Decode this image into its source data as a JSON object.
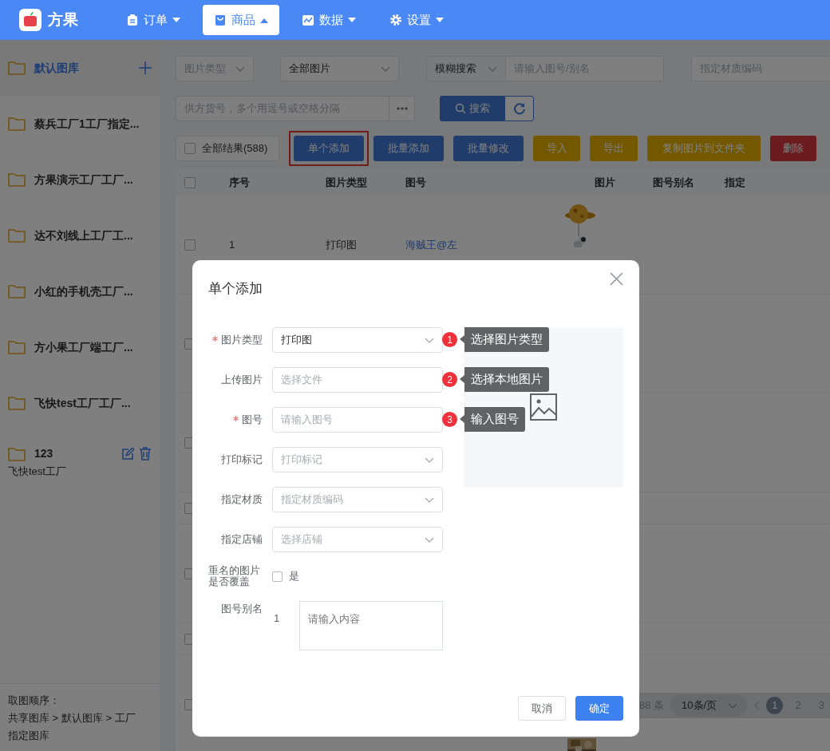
{
  "nav": {
    "brand": "方果",
    "items": [
      {
        "label": "订单",
        "kind": "clipboard",
        "selected": false
      },
      {
        "label": "商品",
        "kind": "bag",
        "selected": true
      },
      {
        "label": "数据",
        "kind": "chart",
        "selected": false
      },
      {
        "label": "设置",
        "kind": "gear",
        "selected": false
      }
    ]
  },
  "sidebar": {
    "libraries": [
      {
        "name": "默认图库",
        "selected": true,
        "hovered": false
      },
      {
        "name": "蔡兵工厂1工厂指定...",
        "selected": false,
        "hovered": false
      },
      {
        "name": "方果演示工厂工厂...",
        "selected": false,
        "hovered": false
      },
      {
        "name": "达不刘线上工厂工...",
        "selected": false,
        "hovered": false
      },
      {
        "name": "小红的手机壳工厂...",
        "selected": false,
        "hovered": false
      },
      {
        "name": "方小果工厂端工厂...",
        "selected": false,
        "hovered": false
      },
      {
        "name": "飞快test工厂工厂...",
        "selected": false,
        "hovered": false
      },
      {
        "name": "123",
        "subtitle": "飞快test工厂",
        "selected": false,
        "hovered": true
      }
    ],
    "note_title": "取图顺序：",
    "note": "共享图库 > 默认图库 > 工厂指定图库"
  },
  "filters": {
    "type_placeholder": "图片类型",
    "scope_value": "全部图片",
    "search_mode": "模糊搜索",
    "search_placeholder": "请输入图号/别名",
    "material_placeholder": "指定材质编码",
    "supplier_placeholder": "供方货号，多个用逗号或空格分隔",
    "search_button": "搜索"
  },
  "toolbar": {
    "select_all": {
      "label": "全部结果(588)",
      "checked": false
    },
    "buttons": [
      {
        "label": "单个添加",
        "kind": "primary",
        "highlighted": true
      },
      {
        "label": "批量添加",
        "kind": "primary",
        "highlighted": false
      },
      {
        "label": "批量修改",
        "kind": "primary",
        "highlighted": false
      },
      {
        "label": "导入",
        "kind": "warning",
        "highlighted": false
      },
      {
        "label": "导出",
        "kind": "warning",
        "highlighted": false
      },
      {
        "label": "复制图片到文件夹",
        "kind": "warning",
        "highlighted": false
      },
      {
        "label": "删除",
        "kind": "danger",
        "highlighted": false
      }
    ]
  },
  "table": {
    "header_checked": false,
    "columns": [
      "序号",
      "图片类型",
      "图号",
      "图片",
      "图号别名",
      "指定"
    ],
    "rows": [
      {
        "kind": "picture",
        "checked": false,
        "cells": [
          "1",
          "打印图",
          "海贼王@左"
        ]
      },
      {
        "kind": "tall",
        "checked": false
      },
      {
        "kind": "tall",
        "checked": false
      },
      {
        "kind": "short",
        "checked": false
      },
      {
        "kind": "tall",
        "checked": false
      },
      {
        "kind": "short",
        "checked": false
      },
      {
        "kind": "picture",
        "checked": false
      }
    ]
  },
  "pagination": {
    "total": "88 条",
    "page_size": "10条/页",
    "pages": [
      {
        "label": "1",
        "selected": true
      },
      {
        "label": "2",
        "selected": false
      },
      {
        "label": "3",
        "selected": false
      }
    ]
  },
  "dialog": {
    "title": "单个添加",
    "fields": [
      {
        "kind": "select",
        "label": "图片类型",
        "required": true,
        "value": "打印图",
        "hint": {
          "number": "1",
          "text": "选择图片类型"
        }
      },
      {
        "kind": "input",
        "label": "上传图片",
        "required": false,
        "placeholder": "选择文件",
        "hint": {
          "number": "2",
          "text": "选择本地图片"
        }
      },
      {
        "kind": "input",
        "label": "图号",
        "required": true,
        "placeholder": "请输入图号",
        "hint": {
          "number": "3",
          "text": "输入图号"
        }
      },
      {
        "kind": "select",
        "label": "打印标记",
        "required": false,
        "placeholder": "打印标记"
      },
      {
        "kind": "select",
        "label": "指定材质",
        "required": false,
        "placeholder": "指定材质编码"
      },
      {
        "kind": "select",
        "label": "指定店铺",
        "required": false,
        "placeholder": "选择店铺"
      }
    ],
    "overwrite": {
      "label": "重名的图片是否覆盖",
      "option": "是",
      "checked": false
    },
    "alias": {
      "label": "图号别名",
      "index": "1",
      "placeholder": "请输入内容"
    },
    "buttons": [
      {
        "label": "取消",
        "kind": "default"
      },
      {
        "label": "确定",
        "kind": "primary"
      }
    ]
  }
}
